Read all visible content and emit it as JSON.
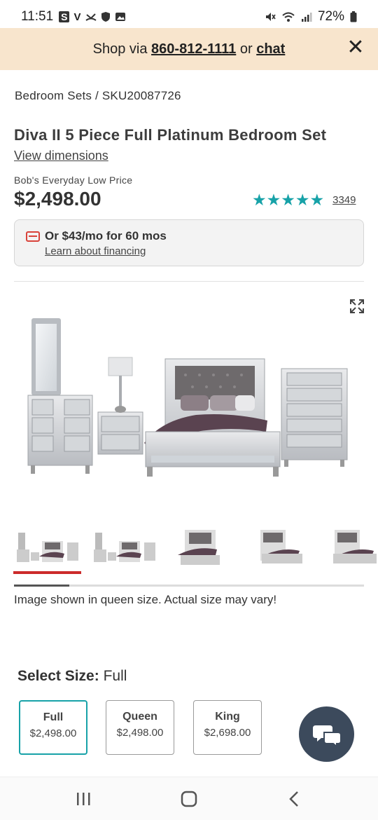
{
  "status_bar": {
    "time": "11:51",
    "left_icons": [
      "S",
      "V"
    ],
    "battery": "72%"
  },
  "promo": {
    "prefix": "Shop via",
    "phone": "860-812-1111",
    "middle": "or",
    "chat": "chat"
  },
  "breadcrumb": "Bedroom Sets /  SKU20087726",
  "product": {
    "title": "Diva II 5 Piece Full Platinum Bedroom Set",
    "dimensions_link": "View dimensions",
    "price_label": "Bob's Everyday Low Price",
    "price": "$2,498.00",
    "rating": 5,
    "stars": "★★★★★",
    "review_count": "3349"
  },
  "financing": {
    "main": "Or $43/mo for 60 mos",
    "link": "Learn about financing"
  },
  "gallery": {
    "note": "Image shown in queen size. Actual size may vary!",
    "thumb_count": 5,
    "active_index": 0
  },
  "size_select": {
    "label": "Select Size:",
    "selected": "Full",
    "options": [
      {
        "name": "Full",
        "price": "$2,498.00"
      },
      {
        "name": "Queen",
        "price": "$2,498.00"
      },
      {
        "name": "King",
        "price": "$2,698.00"
      }
    ]
  },
  "colors": {
    "accent": "#17a2a8",
    "promo_bg": "#f8e5cd",
    "active_thumb": "#cc2b2b",
    "chat_fab": "#3c4a5c"
  }
}
